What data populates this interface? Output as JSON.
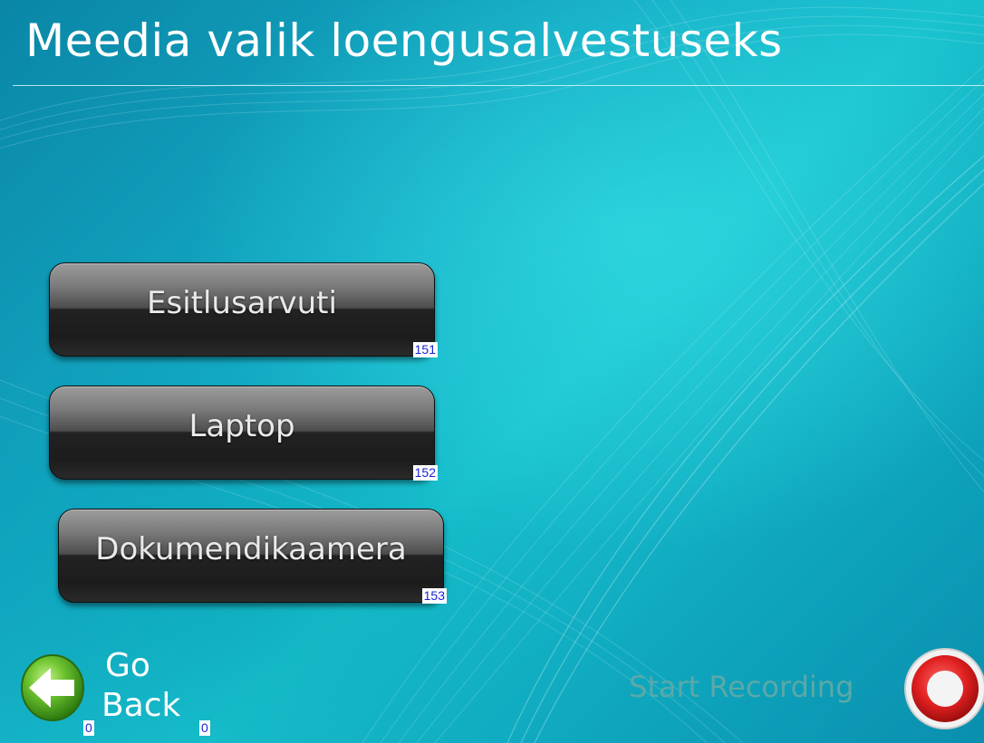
{
  "screen": {
    "title": "Meedia valik loengusalvestuseks"
  },
  "sources": [
    {
      "label": "Esitlusarvuti",
      "code": "151"
    },
    {
      "label": "Laptop",
      "code": "152"
    },
    {
      "label": "Dokumendikaamera",
      "code": "153"
    }
  ],
  "footer": {
    "go_back_line1": "Go",
    "go_back_line2": "Back",
    "go_back_code_left": "0",
    "go_back_code_right": "0",
    "start_recording_label": "Start Recording"
  },
  "icons": {
    "go_back": "back-arrow-icon",
    "record": "record-icon"
  },
  "colors": {
    "accent_background": "#13a9c3",
    "button_dark": "#1c1c1c",
    "record_red": "#e02020",
    "code_text": "#1a22d8",
    "disabled_text": "#5aa9a8"
  }
}
